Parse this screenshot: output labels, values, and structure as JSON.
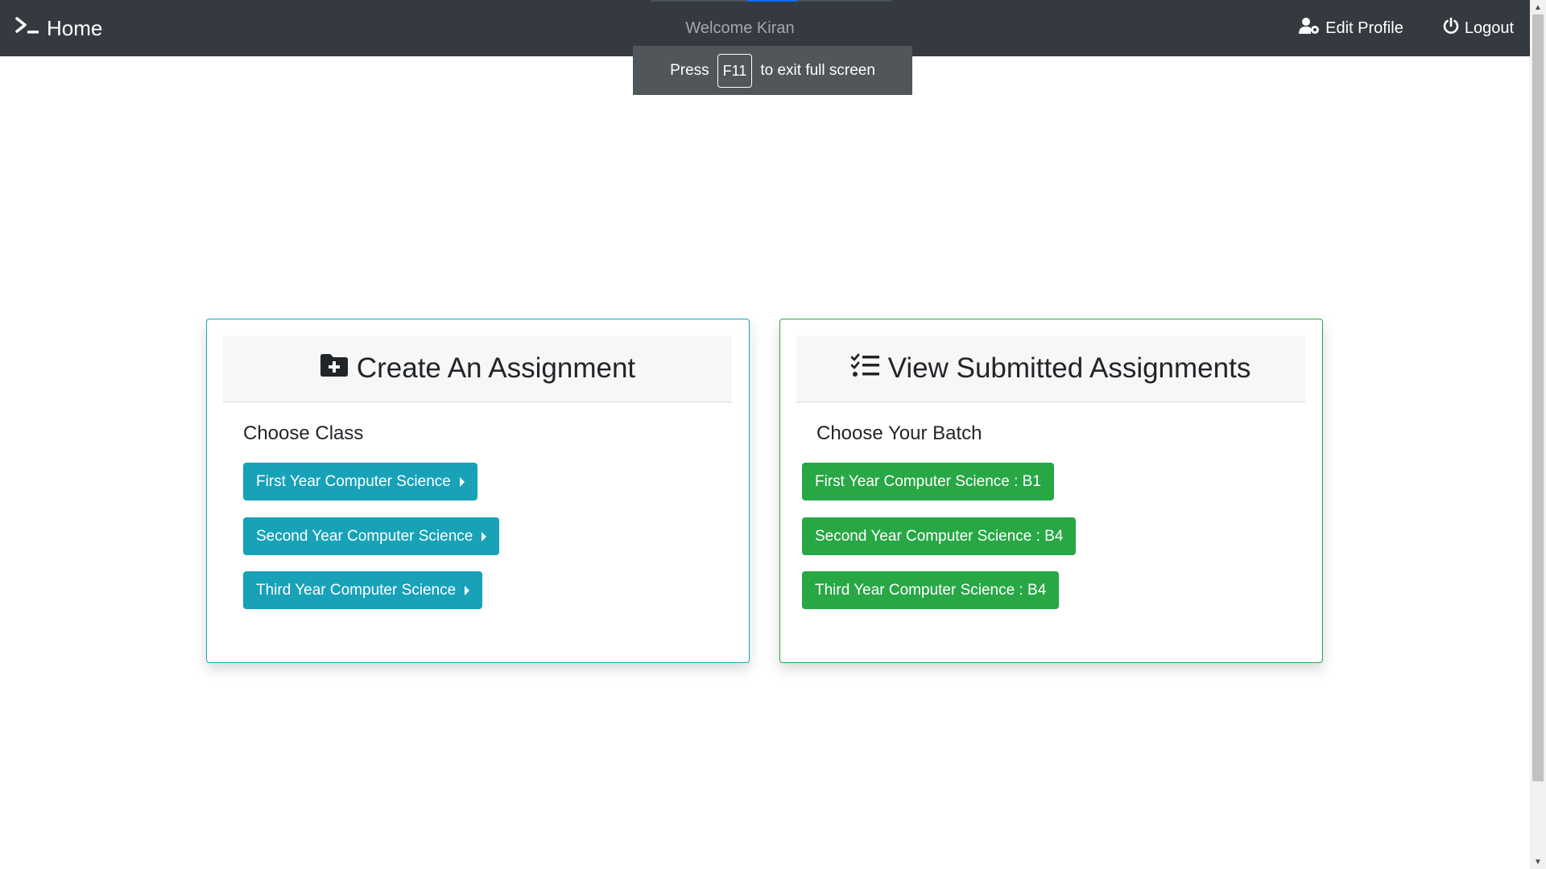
{
  "navbar": {
    "brand_label": "Home",
    "welcome_text": "Welcome Kiran",
    "edit_profile_label": "Edit Profile",
    "logout_label": "Logout"
  },
  "fullscreen_notice": {
    "prefix": "Press",
    "key": "F11",
    "suffix": "to exit full screen"
  },
  "create_card": {
    "title": "Create An Assignment",
    "subtitle": "Choose Class",
    "buttons": [
      {
        "label": "First Year Computer Science"
      },
      {
        "label": "Second Year Computer Science"
      },
      {
        "label": "Third Year Computer Science"
      }
    ]
  },
  "view_card": {
    "title": "View Submitted Assignments",
    "subtitle": "Choose Your Batch",
    "buttons": [
      {
        "label": "First Year Computer Science : B1"
      },
      {
        "label": "Second Year Computer Science : B4"
      },
      {
        "label": "Third Year Computer Science : B4"
      }
    ]
  },
  "colors": {
    "navbar_bg": "#343a40",
    "info": "#17a2b8",
    "success": "#28a745"
  },
  "icons": {
    "brand": "terminal-icon",
    "edit_profile": "user-cog-icon",
    "logout": "power-icon",
    "create": "folder-plus-icon",
    "view": "tasks-list-icon"
  }
}
